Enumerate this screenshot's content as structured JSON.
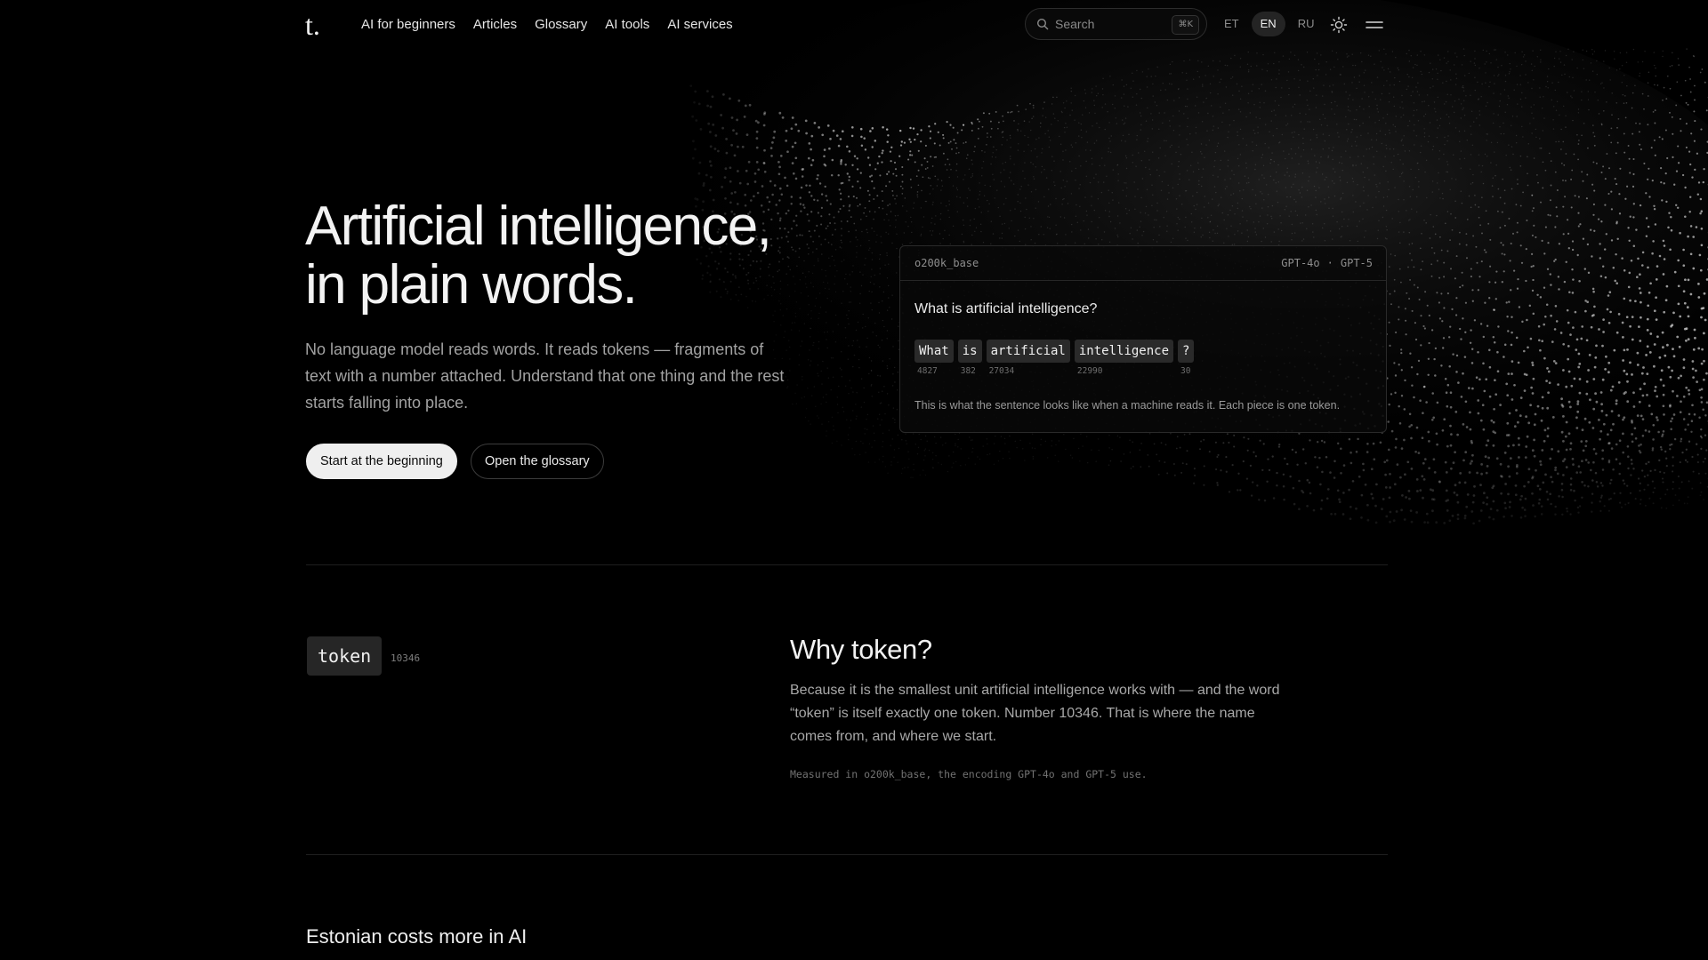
{
  "logo": "t.",
  "nav": [
    {
      "label": "AI for beginners"
    },
    {
      "label": "Articles"
    },
    {
      "label": "Glossary"
    },
    {
      "label": "AI tools"
    },
    {
      "label": "AI services"
    }
  ],
  "search": {
    "placeholder": "Search",
    "shortcut": "⌘K"
  },
  "languages": {
    "items": [
      "ET",
      "EN",
      "RU"
    ],
    "active": "EN"
  },
  "icons": {
    "theme": "sun-icon",
    "menu": "hamburger-menu-icon",
    "search": "search-icon"
  },
  "hero": {
    "title_line1": "Artificial intelligence,",
    "title_line2": "in plain words.",
    "subtitle": "No language model reads words. It reads tokens — fragments of text with a number attached. Understand that one thing and the rest starts falling into place.",
    "primary_button": "Start at the beginning",
    "secondary_button": "Open the glossary"
  },
  "token_card": {
    "encoding": "o200k_base",
    "models": [
      "GPT-4o",
      "·",
      "GPT-5"
    ],
    "question": "What is artificial intelligence?",
    "tokens": [
      {
        "text": "What",
        "id": "4827"
      },
      {
        "text": "is",
        "id": "382"
      },
      {
        "text": "artificial",
        "id": "27034"
      },
      {
        "text": "intelligence",
        "id": "22990"
      },
      {
        "text": "?",
        "id": "30"
      }
    ],
    "caption": "This is what the sentence looks like when a machine reads it. Each piece is one token."
  },
  "why_section": {
    "token_word": "token",
    "token_id": "10346",
    "title": "Why token?",
    "body": "Because it is the smallest unit artificial intelligence works with — and the word “token” is itself exactly one token. Number 10346. That is where the name comes from, and where we start.",
    "note": "Measured in o200k_base, the encoding GPT-4o and GPT-5 use."
  },
  "costs_section": {
    "title": "Estonian costs more in AI"
  },
  "colors": {
    "background": "#000000",
    "text": "#f3f3f3",
    "muted": "#a2a2a2",
    "chip": "#2a2a2a",
    "primary_button_bg": "#efefef"
  }
}
